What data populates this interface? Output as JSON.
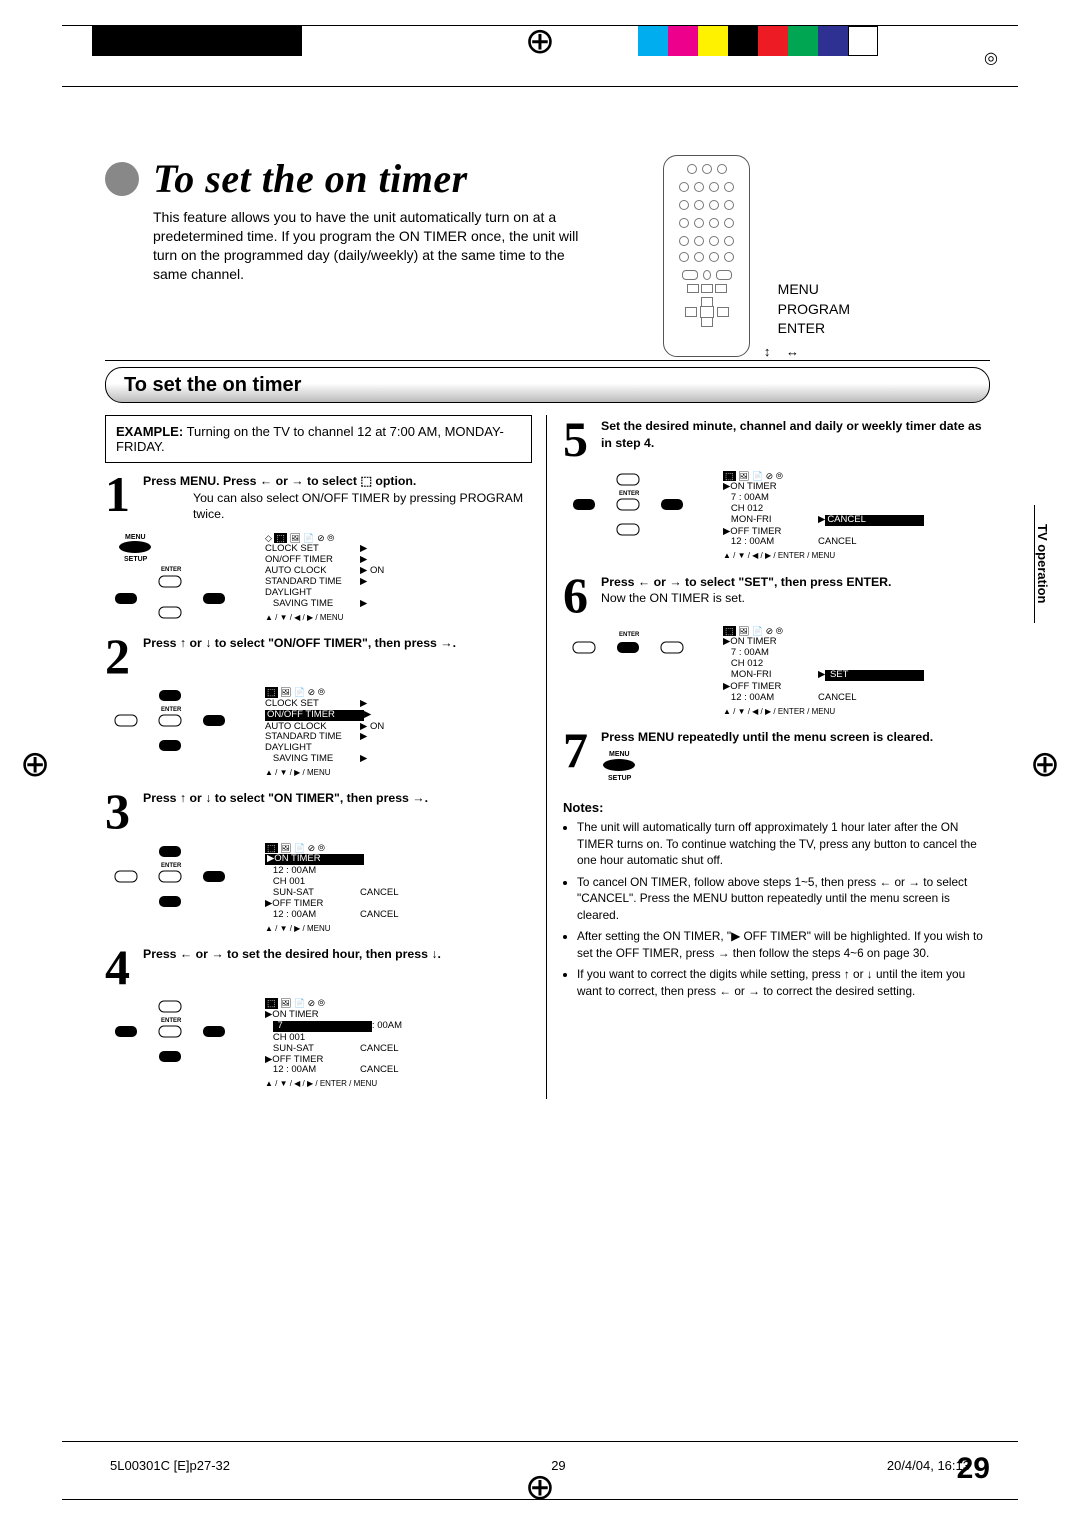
{
  "page_title": "To set the on timer",
  "intro": "This feature allows you to have the unit automatically turn on at a predetermined time. If you program the ON TIMER once, the unit will turn on the programmed day (daily/weekly) at the same time to the same channel.",
  "remote_labels": {
    "l1": "MENU",
    "l2": "PROGRAM",
    "l3": "ENTER",
    "arrows": "↑ ↓ ← →"
  },
  "section_header": "To set the on timer",
  "example": {
    "label": "EXAMPLE:",
    "text": "Turning on the TV to channel 12 at 7:00 AM, MONDAY-FRIDAY."
  },
  "steps": {
    "s1": {
      "line": "Press MENU. Press ← or → to select ⬚ option.",
      "sub": "You can also select ON/OFF TIMER by pressing PROGRAM twice."
    },
    "s2": {
      "line": "Press ↑ or ↓ to select \"ON/OFF TIMER\", then press →."
    },
    "s3": {
      "line": "Press ↑ or ↓ to select \"ON TIMER\", then press →."
    },
    "s4": {
      "line": "Press ← or → to set the desired hour, then press ↓."
    },
    "s5": {
      "line": "Set the desired minute, channel and daily or weekly timer date as in step 4."
    },
    "s6": {
      "line": "Press ← or → to select \"SET\", then press ENTER.",
      "sub": "Now the ON TIMER is set."
    },
    "s7": {
      "line": "Press MENU repeatedly until the menu screen is cleared."
    }
  },
  "osd": {
    "clock_icon": "⬚",
    "s1_rows": [
      [
        "CLOCK SET",
        "▶"
      ],
      [
        "ON/OFF TIMER",
        "▶"
      ],
      [
        "AUTO CLOCK",
        "▶ ON"
      ],
      [
        "STANDARD TIME",
        "▶"
      ],
      [
        "DAYLIGHT",
        ""
      ],
      [
        "   SAVING TIME",
        "▶"
      ]
    ],
    "s1_legend": "▲ / ▼ / ◀ / ▶ / MENU",
    "s2_rows": [
      [
        "CLOCK SET",
        "▶"
      ],
      [
        "ON/OFF TIMER",
        "▶"
      ],
      [
        "AUTO CLOCK",
        "▶ ON"
      ],
      [
        "STANDARD TIME",
        "▶"
      ],
      [
        "DAYLIGHT",
        ""
      ],
      [
        "   SAVING TIME",
        "▶"
      ]
    ],
    "s2_hl": 1,
    "s2_legend": "▲ / ▼ / ▶ / MENU",
    "s3_rows": [
      [
        "▶ON TIMER",
        ""
      ],
      [
        "   12 : 00AM",
        ""
      ],
      [
        "   CH 001",
        ""
      ],
      [
        "   SUN-SAT",
        "CANCEL"
      ],
      [
        "▶OFF TIMER",
        ""
      ],
      [
        "   12 : 00AM",
        "CANCEL"
      ]
    ],
    "s3_hl": 0,
    "s3_legend": "▲ / ▼ / ▶ / MENU",
    "s4_rows": [
      [
        "▶ON TIMER",
        ""
      ],
      [
        "   ▮7▮: 00AM",
        ""
      ],
      [
        "   CH 001",
        ""
      ],
      [
        "   SUN-SAT",
        "CANCEL"
      ],
      [
        "▶OFF TIMER",
        ""
      ],
      [
        "   12 : 00AM",
        "CANCEL"
      ]
    ],
    "s4_legend": "▲ / ▼ / ◀ / ▶ / ENTER / MENU",
    "s5_rows": [
      [
        "▶ON TIMER",
        ""
      ],
      [
        "   7 : 00AM",
        ""
      ],
      [
        "   CH 012",
        ""
      ],
      [
        "   MON-FRI",
        "▶CANCEL"
      ],
      [
        "▶OFF TIMER",
        ""
      ],
      [
        "   12 : 00AM",
        "CANCEL"
      ]
    ],
    "s5_legend": "▲ / ▼ / ◀ / ▶ / ENTER / MENU",
    "s6_rows": [
      [
        "▶ON TIMER",
        ""
      ],
      [
        "   7 : 00AM",
        ""
      ],
      [
        "   CH 012",
        ""
      ],
      [
        "   MON-FRI",
        "▶SET  "
      ],
      [
        "▶OFF TIMER",
        ""
      ],
      [
        "   12 : 00AM",
        "CANCEL"
      ]
    ],
    "s6_legend": "▲ / ▼ / ◀ / ▶ / ENTER / MENU"
  },
  "remote_pad": {
    "menu": "MENU",
    "setup": "SETUP",
    "enter": "ENTER"
  },
  "notes_header": "Notes:",
  "notes": [
    "The unit will automatically turn off approximately 1 hour later after the ON TIMER turns on. To continue watching the TV, press any button to cancel the one hour automatic shut off.",
    "To cancel ON TIMER, follow above steps 1~5, then press ← or → to select \"CANCEL\". Press the MENU button repeatedly until the menu screen is cleared.",
    "After setting the ON TIMER, \"▶ OFF TIMER\" will be highlighted. If you wish to set the OFF TIMER, press → then follow the steps 4~6 on page 30.",
    "If you want to correct the digits while setting, press ↑ or ↓ until the item you want to correct, then press ← or → to correct the desired setting."
  ],
  "page_number": "29",
  "side_tab": "TV operation",
  "footer": {
    "left": "5L00301C [E]p27-32",
    "mid": "29",
    "right": "20/4/04, 16:13"
  },
  "swatches": [
    "#00aeef",
    "#ec008c",
    "#fff200",
    "#000000",
    "#ed1c24",
    "#00a651",
    "#2e3192",
    "#ffffff"
  ]
}
